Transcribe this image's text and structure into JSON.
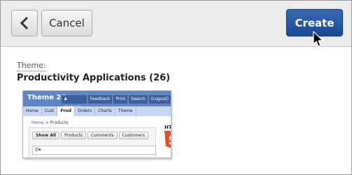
{
  "toolbar": {
    "back_icon": "chevron-left-icon",
    "cancel_label": "Cancel",
    "create_label": "Create",
    "create_color": "#1b4a93"
  },
  "content": {
    "theme_label": "Theme:",
    "theme_name": "Productivity Applications (26)"
  },
  "preview": {
    "title": "Theme 26",
    "user_bar": [
      "shakeeb",
      "Feedback",
      "Print",
      "Search",
      "(Logout)"
    ],
    "nav_tabs": [
      "Home",
      "Cust",
      "Prod",
      "Orders",
      "Charts",
      "Theme"
    ],
    "active_nav": "Prod",
    "breadcrumb_home": "Home",
    "breadcrumb_sep": ">",
    "breadcrumb_current": "Products",
    "filter_tabs": [
      "Show All",
      "Products",
      "Comments",
      "Customers"
    ],
    "html5_text": "HTML",
    "html5_number": "5",
    "header_color": "#5f86c4",
    "nav_color": "#c7d7ef"
  }
}
